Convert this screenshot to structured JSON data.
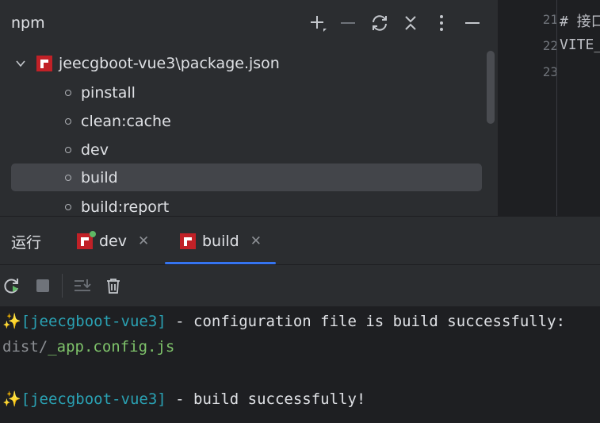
{
  "npm_panel": {
    "title": "npm",
    "header_icons": [
      "plus-icon",
      "minus-icon",
      "refresh-icon",
      "collapse-icon",
      "more-icon",
      "hide-icon"
    ],
    "root": {
      "label": "jeecgboot-vue3\\package.json",
      "expanded": true
    },
    "scripts": [
      {
        "label": "pinstall",
        "selected": false
      },
      {
        "label": "clean:cache",
        "selected": false
      },
      {
        "label": "dev",
        "selected": false
      },
      {
        "label": "build",
        "selected": true
      },
      {
        "label": "build:report",
        "selected": false
      }
    ]
  },
  "editor": {
    "line_numbers": [
      "21",
      "22",
      "23"
    ],
    "lines": [
      "# 接口",
      "VITE_",
      ""
    ]
  },
  "run_panel": {
    "title": "运行",
    "tabs": [
      {
        "label": "dev",
        "running": true,
        "active": false
      },
      {
        "label": "build",
        "running": false,
        "active": true
      }
    ],
    "toolbar": [
      "rerun-icon",
      "stop-icon",
      "scroll-to-end-icon",
      "clear-icon"
    ],
    "console": {
      "line1": {
        "icon": "✨",
        "project": "[jeecgboot-vue3]",
        "text": " - configuration file is build successfully:"
      },
      "line2": {
        "dir": "dist/",
        "file": "_app.config.js"
      },
      "line3": {
        "icon": "✨",
        "project": "[jeecgboot-vue3]",
        "text": " - build successfully!"
      }
    }
  },
  "colors": {
    "panel_bg": "#2b2d30",
    "editor_bg": "#1e1f22",
    "selected_bg": "#43454a",
    "accent": "#3574f0",
    "npm_red": "#c12127",
    "console_teal": "#2aa1b3",
    "console_green": "#7ec26a"
  }
}
